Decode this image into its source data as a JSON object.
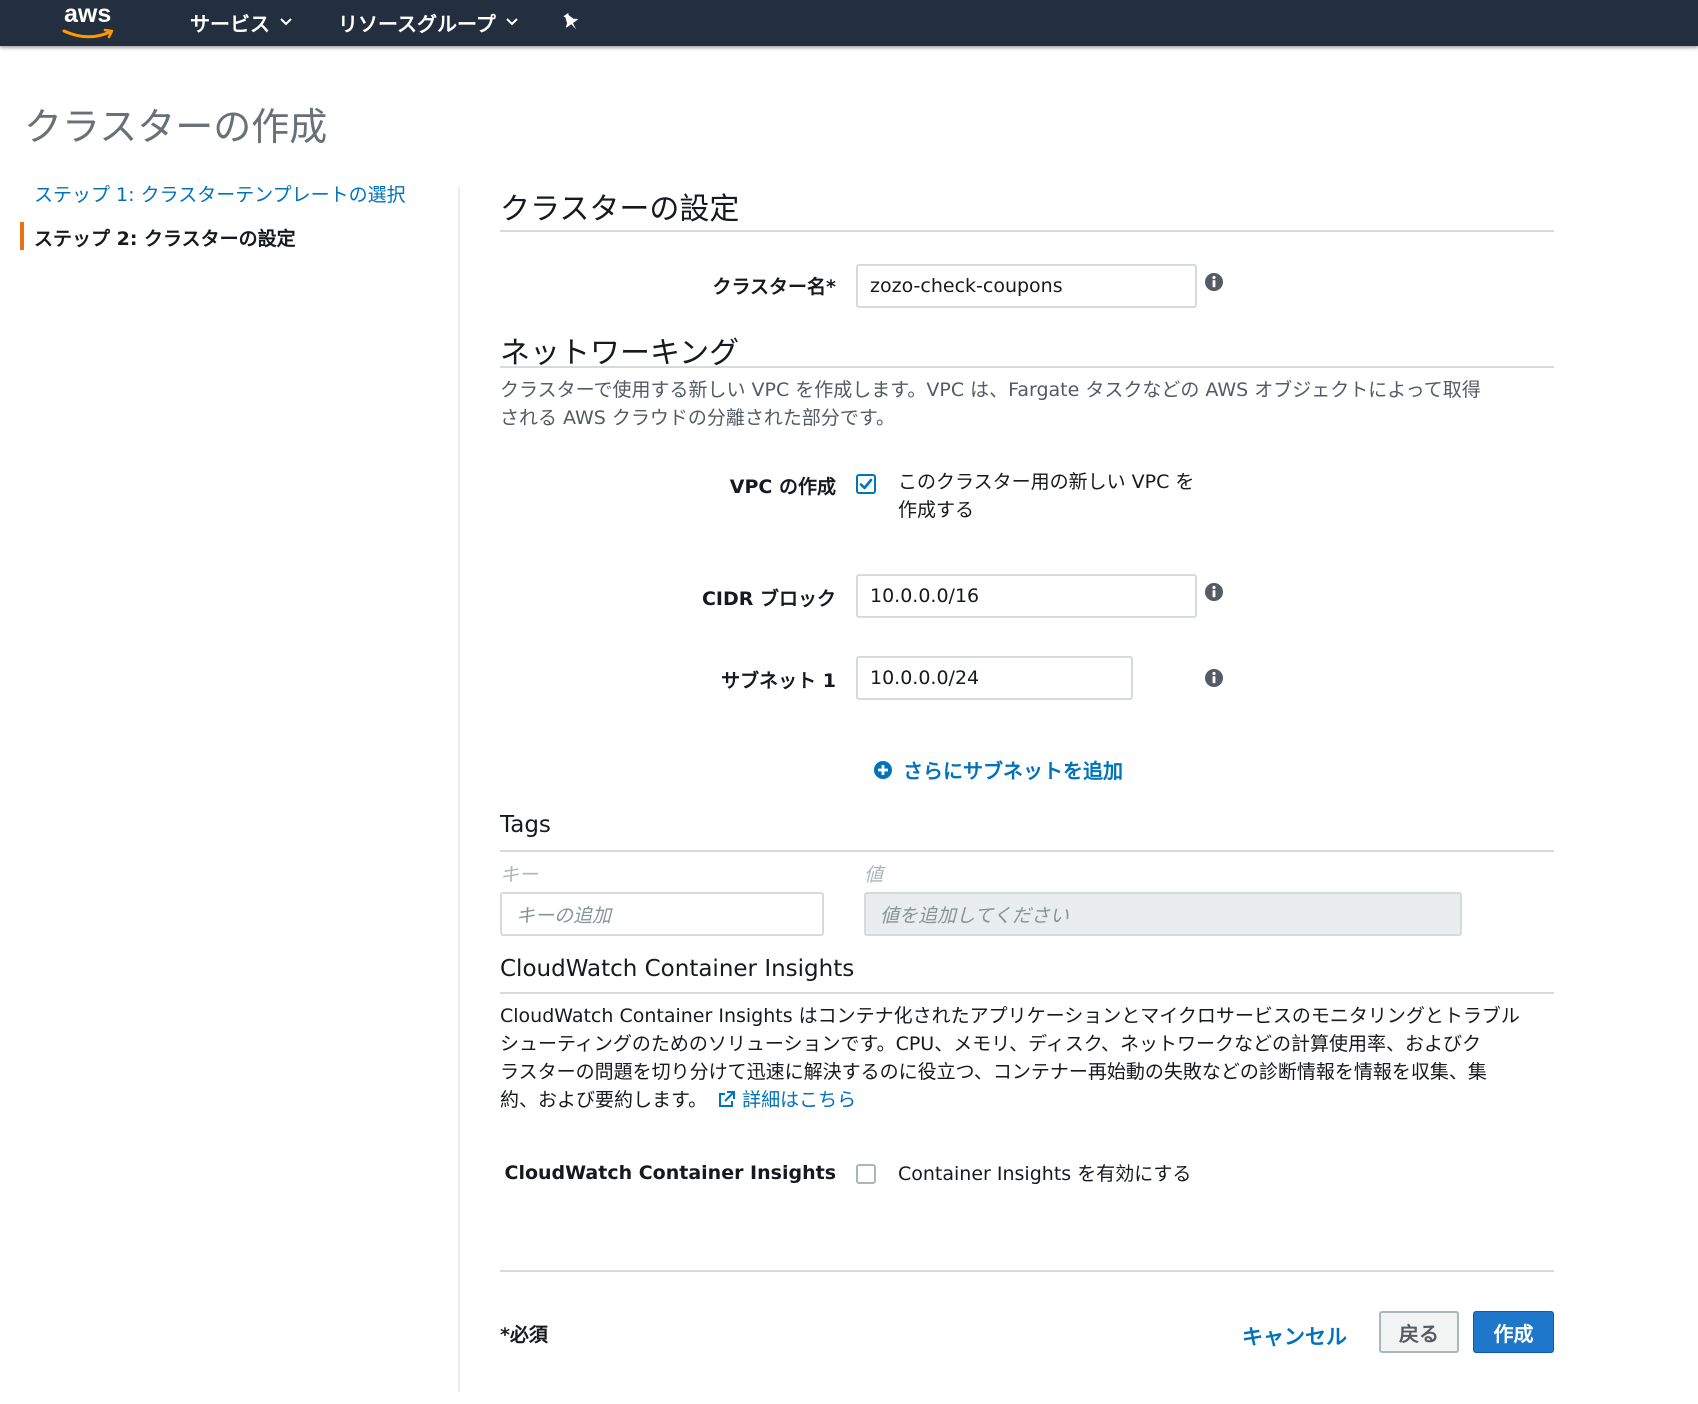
{
  "nav": {
    "logo_text": "aws",
    "services_label": "サービス",
    "resource_groups_label": "リソースグループ"
  },
  "page": {
    "title": "クラスターの作成"
  },
  "sidebar": {
    "steps": [
      {
        "label": "ステップ 1: クラスターテンプレートの選択",
        "active": false
      },
      {
        "label": "ステップ 2: クラスターの設定",
        "active": true
      }
    ]
  },
  "cluster_settings": {
    "heading": "クラスターの設定",
    "cluster_name_label": "クラスター名*",
    "cluster_name_value": "zozo-check-coupons"
  },
  "networking": {
    "heading": "ネットワーキング",
    "description_line1": "クラスターで使用する新しい VPC を作成します。VPC は、Fargate タスクなどの AWS オブジェクトによって取得",
    "description_line2": "される AWS クラウドの分離された部分です。",
    "vpc_label": "VPC の作成",
    "vpc_checked": true,
    "vpc_text_line1": "このクラスター用の新しい VPC を",
    "vpc_text_line2": "作成する",
    "cidr_label": "CIDR ブロック",
    "cidr_value": "10.0.0.0/16",
    "subnet_label": "サブネット 1",
    "subnet_value": "10.0.0.0/24",
    "add_subnet_label": "さらにサブネットを追加"
  },
  "tags": {
    "heading": "Tags",
    "key_label": "キー",
    "value_label": "値",
    "key_placeholder": "キーの追加",
    "value_placeholder": "値を追加してください"
  },
  "insights": {
    "heading": "CloudWatch Container Insights",
    "description_line1": "CloudWatch Container Insights はコンテナ化されたアプリケーションとマイクロサービスのモニタリングとトラブル",
    "description_line2": "シューティングのためのソリューションです。CPU、メモリ、ディスク、ネットワークなどの計算使用率、およびク",
    "description_line3": "ラスターの問題を切り分けて迅速に解決するのに役立つ、コンテナー再始動の失敗などの診断情報を情報を収集、集",
    "description_line4": "約、および要約します。",
    "learn_more_label": "詳細はこちら",
    "option_label": "CloudWatch Container Insights",
    "option_text": "Container Insights を有効にする",
    "option_checked": false
  },
  "footer": {
    "required_note": "*必須",
    "cancel_label": "キャンセル",
    "back_label": "戻る",
    "create_label": "作成"
  },
  "colors": {
    "nav_bg": "#232f3e",
    "link": "#0073bb",
    "accent": "#ec7211",
    "primary_button": "#1f77cc"
  }
}
